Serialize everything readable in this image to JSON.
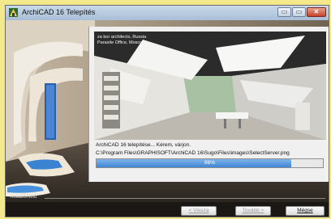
{
  "window": {
    "title": "ArchiCAD 16 Telepítés",
    "minimize_label": "▭",
    "maximize_label": "▭",
    "close_label": "✕"
  },
  "photo": {
    "caption_line1": "za bor architects, Russia",
    "caption_line2": "Parasite Office, Moscow"
  },
  "install": {
    "status_text": "ArchiCAD 16 telepítése... Kérem, várjon.",
    "current_file": "C:\\Program Files\\GRAPHISOFT\\ArchiCAD 16\\Sugo\\Files\\images\\SelectServer.png",
    "progress": 0.86,
    "progress_label": "86%"
  },
  "footer": {
    "brand": "InstallShield",
    "back_button": "< Vissza",
    "next_button": "Tovább >",
    "cancel_button": "Mégse"
  },
  "colors": {
    "accent": "#3f86d6",
    "background_highlight": "#f3e88a"
  }
}
